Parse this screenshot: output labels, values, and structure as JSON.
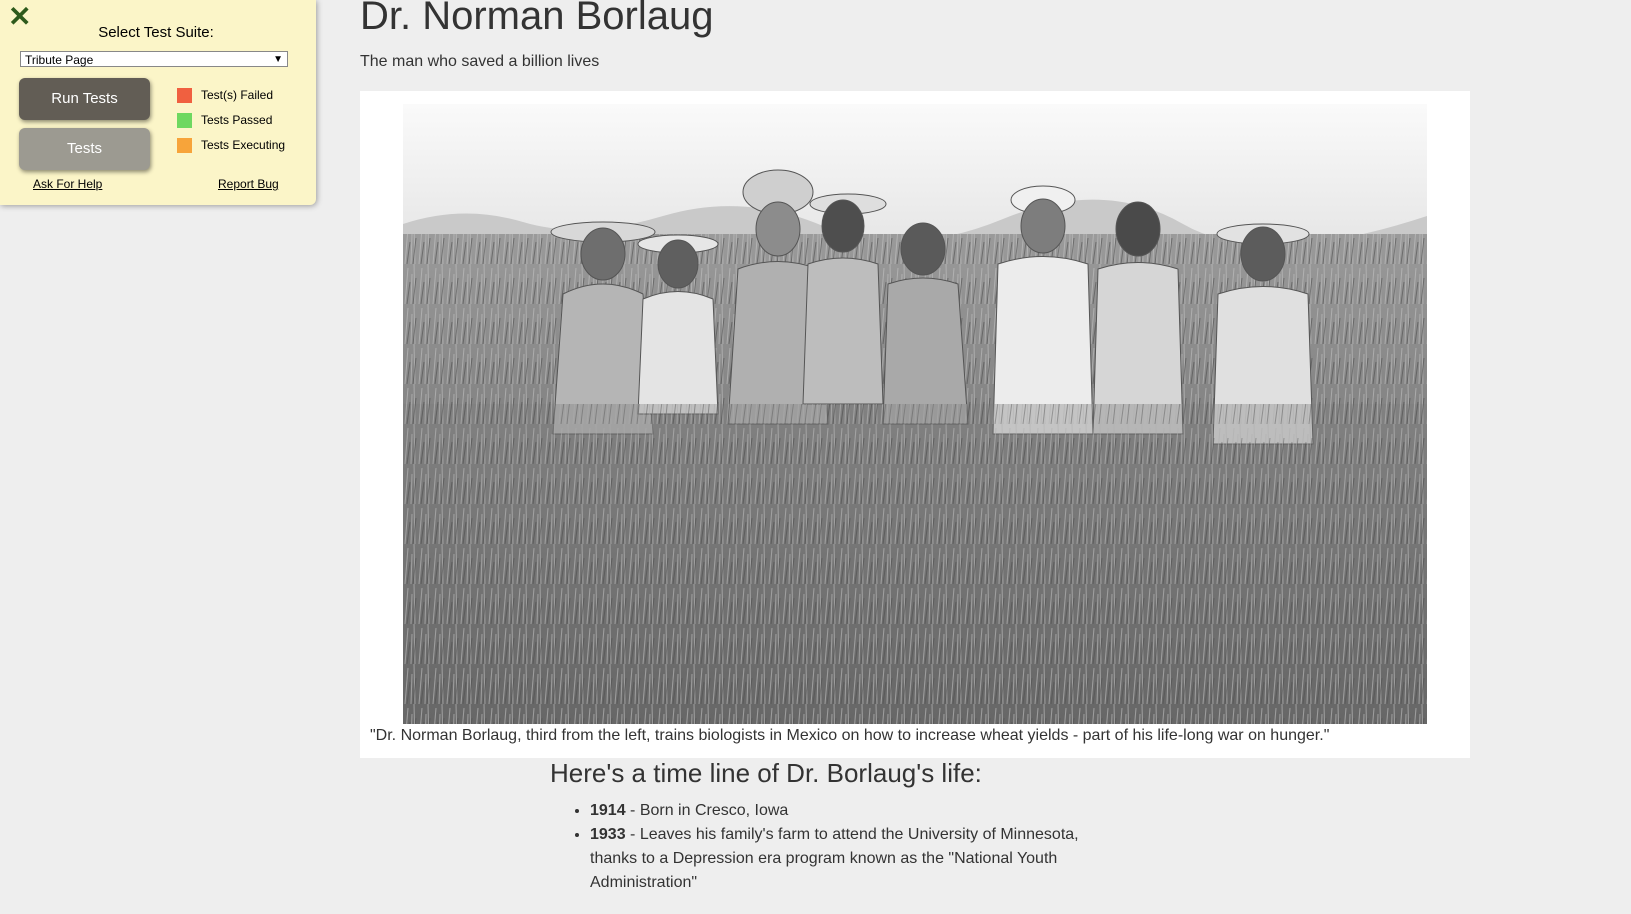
{
  "tribute": {
    "title": "Dr. Norman Borlaug",
    "subtitle": "The man who saved a billion lives",
    "caption": "\"Dr. Norman Borlaug, third from the left, trains biologists in Mexico on how to increase wheat yields - part of his life-long war on hunger.\"",
    "timeline_heading": "Here's a time line of Dr. Borlaug's life:",
    "timeline": [
      {
        "year": "1914",
        "text": " - Born in Cresco, Iowa"
      },
      {
        "year": "1933",
        "text": " - Leaves his family's farm to attend the University of Minnesota, thanks to a Depression era program known as the \"National Youth Administration\""
      }
    ]
  },
  "fcc_panel": {
    "close_icon": "close-icon",
    "suite_label": "Select Test Suite:",
    "selected_suite": "Tribute Page",
    "run_button": "Run Tests",
    "tests_button": "Tests",
    "legend": [
      {
        "label": "Test(s) Failed",
        "color": "#f06040"
      },
      {
        "label": "Tests Passed",
        "color": "#6ed860"
      },
      {
        "label": "Tests Executing",
        "color": "#f7a43a"
      }
    ],
    "help_link": "Ask For Help",
    "bug_link": "Report Bug"
  },
  "colors": {
    "page_background": "#eeeeee",
    "panel_background": "#fbf5c8",
    "run_button": "#625d55",
    "tests_button": "#9c9a91",
    "close_icon": "#2d5a1b"
  }
}
